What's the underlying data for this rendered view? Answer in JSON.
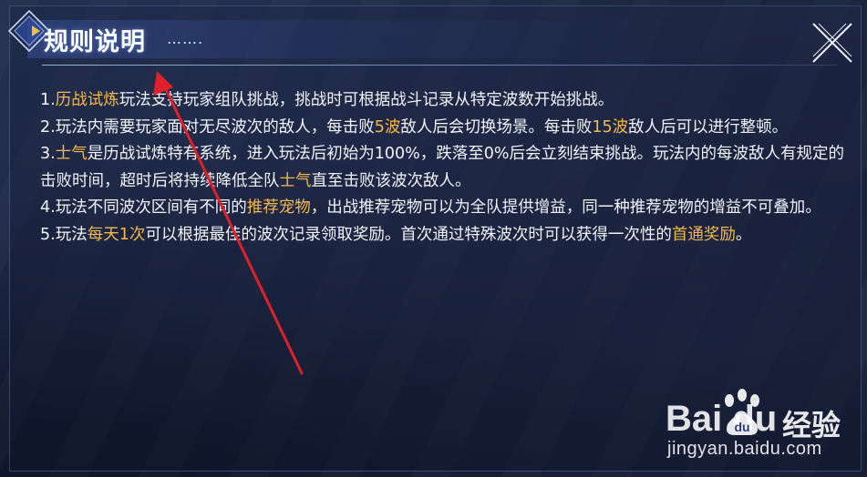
{
  "header": {
    "title": "规则说明",
    "title_dots": "……."
  },
  "rules": [
    {
      "segments": [
        {
          "text": "1.",
          "highlight": false
        },
        {
          "text": "历战试炼",
          "highlight": true
        },
        {
          "text": "玩法支持玩家组队挑战，挑战时可根据战斗记录从特定波数开始挑战。",
          "highlight": false
        }
      ]
    },
    {
      "segments": [
        {
          "text": "2.玩法内需要玩家面对无尽波次的敌人，每击败",
          "highlight": false
        },
        {
          "text": "5波",
          "highlight": true
        },
        {
          "text": "敌人后会切换场景。每击败",
          "highlight": false
        },
        {
          "text": "15波",
          "highlight": true
        },
        {
          "text": "敌人后可以进行整顿。",
          "highlight": false
        }
      ]
    },
    {
      "segments": [
        {
          "text": "3.",
          "highlight": false
        },
        {
          "text": "士气",
          "highlight": true
        },
        {
          "text": "是历战试炼特有系统，进入玩法后初始为100%，跌落至0%后会立刻结束挑战。玩法内的每波敌人有规定的击败时间，超时后将持续降低全队",
          "highlight": false
        },
        {
          "text": "士气",
          "highlight": true
        },
        {
          "text": "直至击败该波次敌人。",
          "highlight": false
        }
      ]
    },
    {
      "segments": [
        {
          "text": "4.玩法不同波次区间有不同的",
          "highlight": false
        },
        {
          "text": "推荐宠物",
          "highlight": true
        },
        {
          "text": "，出战推荐宠物可以为全队提供增益，同一种推荐宠物的增益不可叠加。",
          "highlight": false
        }
      ]
    },
    {
      "segments": [
        {
          "text": "5.玩法",
          "highlight": false
        },
        {
          "text": "每天1次",
          "highlight": true
        },
        {
          "text": "可以根据最佳的波次记录领取奖励。首次通过特殊波次时可以获得一次性的",
          "highlight": false
        },
        {
          "text": "首通奖励",
          "highlight": true
        },
        {
          "text": "。",
          "highlight": false
        }
      ]
    }
  ],
  "watermark": {
    "brand": "Bai   du",
    "cn": "经验",
    "url": "jingyan.baidu.com"
  },
  "colors": {
    "highlight": "#f4b94a",
    "text": "#f2f4fa",
    "annotation_arrow": "#e0202a",
    "accent": "#4a6fd0"
  },
  "icons": {
    "close": "close-x-icon",
    "title_badge": "diamond-badge-icon",
    "watermark_logo": "baidu-paw-icon"
  }
}
